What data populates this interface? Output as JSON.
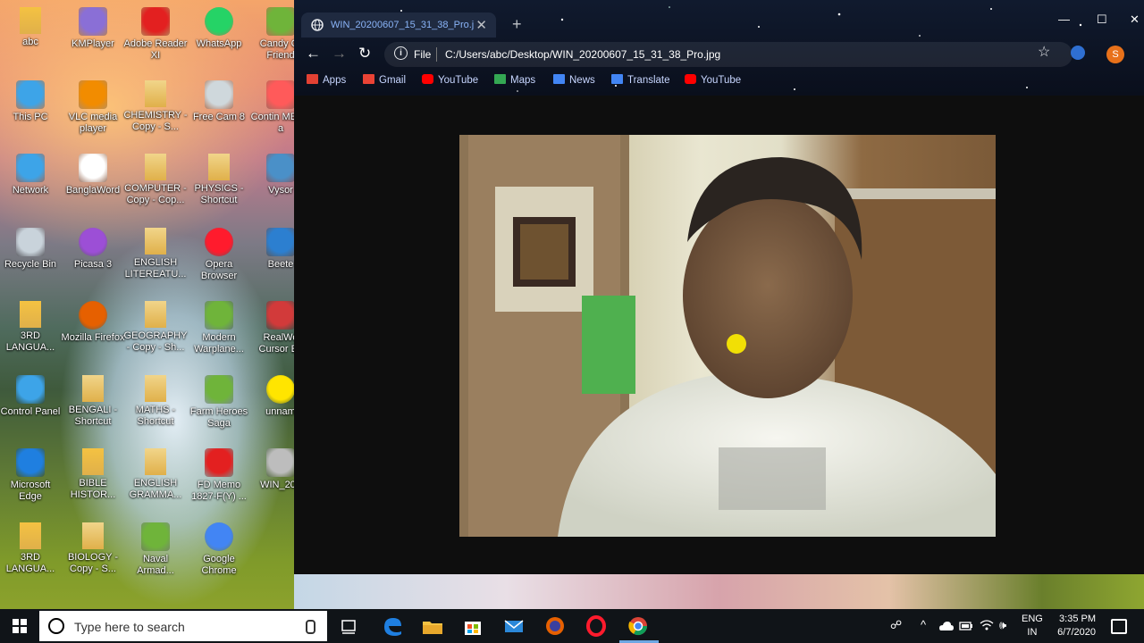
{
  "desktop": {
    "icons": [
      {
        "label": "abc",
        "icon": "user-folder-icon"
      },
      {
        "label": "KMPlayer",
        "icon": "kmplayer-icon"
      },
      {
        "label": "Adobe Reader XI",
        "icon": "pdf-icon"
      },
      {
        "label": "WhatsApp",
        "icon": "whatsapp-icon"
      },
      {
        "label": "Candy Cr Friend",
        "icon": "game-icon"
      },
      {
        "label": "This PC",
        "icon": "computer-icon"
      },
      {
        "label": "VLC media player",
        "icon": "vlc-icon"
      },
      {
        "label": "CHEMISTRY - Copy - S...",
        "icon": "shortcut-icon"
      },
      {
        "label": "Free Cam 8",
        "icon": "camera-icon"
      },
      {
        "label": "Contin MEmu a",
        "icon": "memu-icon"
      },
      {
        "label": "Network",
        "icon": "network-icon"
      },
      {
        "label": "BanglaWord",
        "icon": "banglaword-icon"
      },
      {
        "label": "COMPUTER - Copy - Cop...",
        "icon": "shortcut-icon"
      },
      {
        "label": "PHYSICS - Shortcut",
        "icon": "shortcut-icon"
      },
      {
        "label": "Vysor",
        "icon": "vysor-icon"
      },
      {
        "label": "Recycle Bin",
        "icon": "recycle-bin-icon"
      },
      {
        "label": "Picasa 3",
        "icon": "picasa-icon"
      },
      {
        "label": "ENGLISH LITEREATU...",
        "icon": "shortcut-icon"
      },
      {
        "label": "Opera Browser",
        "icon": "opera-icon"
      },
      {
        "label": "Beete",
        "icon": "beete-icon"
      },
      {
        "label": "3RD LANGUA...",
        "icon": "folder-icon"
      },
      {
        "label": "Mozilla Firefox",
        "icon": "firefox-icon"
      },
      {
        "label": "GEOGRAPHY - Copy - Sh...",
        "icon": "shortcut-icon"
      },
      {
        "label": "Modern Warplane...",
        "icon": "game-icon"
      },
      {
        "label": "RealWo Cursor Ec",
        "icon": "cursor-editor-icon"
      },
      {
        "label": "Control Panel",
        "icon": "control-panel-icon"
      },
      {
        "label": "BENGALI - Shortcut",
        "icon": "shortcut-icon"
      },
      {
        "label": "MATHS - Shortcut",
        "icon": "shortcut-icon"
      },
      {
        "label": "Farm Heroes Saga",
        "icon": "game-icon"
      },
      {
        "label": "unnam",
        "icon": "cursor-icon"
      },
      {
        "label": "Microsoft Edge",
        "icon": "edge-icon"
      },
      {
        "label": "BIBLE HISTOR...",
        "icon": "folder-icon"
      },
      {
        "label": "ENGLISH GRAMMA...",
        "icon": "shortcut-icon"
      },
      {
        "label": "FD Memo 1827-F(Y) ...",
        "icon": "pdf-icon"
      },
      {
        "label": "WIN_202",
        "icon": "image-thumbnail-icon"
      },
      {
        "label": "3RD LANGUA...",
        "icon": "folder-icon"
      },
      {
        "label": "BIOLOGY - Copy - S...",
        "icon": "shortcut-icon"
      },
      {
        "label": "Naval Armad...",
        "icon": "game-icon"
      },
      {
        "label": "Google Chrome",
        "icon": "chrome-icon"
      }
    ]
  },
  "browser": {
    "tab_title": "WIN_20200607_15_31_38_Pro.jpg",
    "tab_close": "✕",
    "new_tab": "+",
    "minimize": "—",
    "maximize": "☐",
    "close": "✕",
    "back": "←",
    "forward": "→",
    "reload": "↻",
    "info": "i",
    "scheme_label": "File",
    "url": "C:/Users/abc/Desktop/WIN_20200607_15_31_38_Pro.jpg",
    "star": "☆",
    "profile_initial": "S",
    "bookmarks": [
      {
        "label": "Apps",
        "icon": "apps-grid-icon",
        "color": "#e34133"
      },
      {
        "label": "Gmail",
        "icon": "gmail-icon",
        "color": "#ea4335"
      },
      {
        "label": "YouTube",
        "icon": "youtube-icon",
        "color": "#ff0000"
      },
      {
        "label": "Maps",
        "icon": "maps-icon",
        "color": "#34a853"
      },
      {
        "label": "News",
        "icon": "news-icon",
        "color": "#4285f4"
      },
      {
        "label": "Translate",
        "icon": "translate-icon",
        "color": "#4285f4"
      },
      {
        "label": "YouTube",
        "icon": "youtube-icon",
        "color": "#ff0000"
      }
    ]
  },
  "taskbar": {
    "search_placeholder": "Type here to search",
    "apps": [
      "task-view-icon",
      "edge-icon",
      "file-explorer-icon",
      "store-icon",
      "mail-icon",
      "firefox-icon",
      "opera-icon",
      "chrome-icon"
    ],
    "lang_line1": "ENG",
    "lang_line2": "IN",
    "time": "3:35 PM",
    "date": "6/7/2020",
    "tray_people": "☍",
    "tray_chevron": "^",
    "tray_volume": "🕪"
  }
}
